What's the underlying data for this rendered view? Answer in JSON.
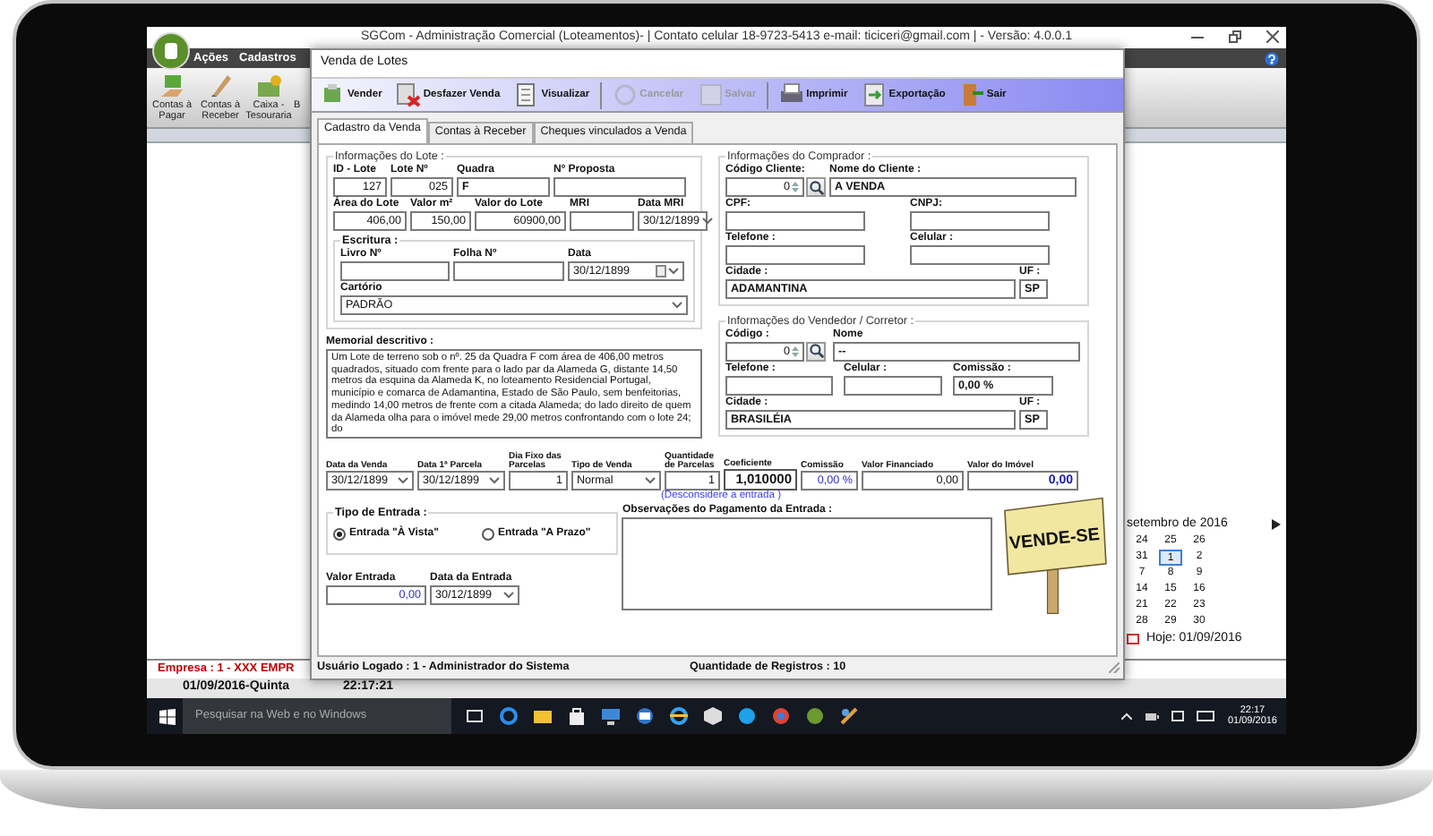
{
  "main_window": {
    "title": "SGCom - Administração Comercial (Loteamentos)- | Contato celular 18-9723-5413 e-mail: ticiceri@gmail.com | - Versão: 4.0.0.1",
    "menu": [
      {
        "label": "Ações"
      },
      {
        "label": "Cadastros"
      }
    ],
    "ribbon": [
      {
        "label": "Contas à Pagar"
      },
      {
        "label": "Contas à Receber"
      },
      {
        "label": "Caixa - Tesouraria"
      },
      {
        "label": "B"
      }
    ],
    "calendar": {
      "month": "setembro de 2016",
      "weeks": [
        [
          {
            "day": "24",
            "selected": false
          },
          {
            "day": "25",
            "selected": false
          },
          {
            "day": "26",
            "selected": false
          }
        ],
        [
          {
            "day": "31",
            "selected": false
          },
          {
            "day": "1",
            "selected": true
          },
          {
            "day": "2",
            "selected": false
          }
        ],
        [
          {
            "day": "7",
            "selected": false
          },
          {
            "day": "8",
            "selected": false
          },
          {
            "day": "9",
            "selected": false
          }
        ],
        [
          {
            "day": "14",
            "selected": false
          },
          {
            "day": "15",
            "selected": false
          },
          {
            "day": "16",
            "selected": false
          }
        ],
        [
          {
            "day": "21",
            "selected": false
          },
          {
            "day": "22",
            "selected": false
          },
          {
            "day": "23",
            "selected": false
          }
        ],
        [
          {
            "day": "28",
            "selected": false
          },
          {
            "day": "29",
            "selected": false
          },
          {
            "day": "30",
            "selected": false
          }
        ]
      ],
      "today": "Hoje: 01/09/2016"
    },
    "status": {
      "company": "Empresa : 1 - XXX EMPR",
      "date": "01/09/2016-Quinta",
      "time": "22:17:21"
    }
  },
  "dialog": {
    "title": "Venda de Lotes",
    "toolbar": [
      {
        "label": "Vender",
        "disabled": false
      },
      {
        "label": "Desfazer Venda",
        "disabled": false
      },
      {
        "label": "Visualizar",
        "disabled": false
      },
      {
        "label": "Cancelar",
        "disabled": true
      },
      {
        "label": "Salvar",
        "disabled": true
      },
      {
        "label": "Imprimir",
        "disabled": false
      },
      {
        "label": "Exportação",
        "disabled": false
      },
      {
        "label": "Sair",
        "disabled": false
      }
    ],
    "tabs": [
      {
        "label": "Cadastro da Venda",
        "selected": true
      },
      {
        "label": "Contas à Receber",
        "selected": false
      },
      {
        "label": "Cheques vinculados a Venda",
        "selected": false
      }
    ],
    "lote": {
      "title": "Informações do Lote :",
      "rows": [
        [
          {
            "label": "ID - Lote",
            "value": "127",
            "kind": "number"
          },
          {
            "label": "Lote Nº",
            "value": "025",
            "kind": "number"
          },
          {
            "label": "Quadra",
            "value": "F",
            "kind": "text"
          },
          {
            "label": "Nº Proposta",
            "kind": "text"
          }
        ],
        [
          {
            "label": "Área do Lote",
            "value": "406,00",
            "kind": "number"
          },
          {
            "label": "Valor m²",
            "value": "150,00",
            "kind": "number"
          },
          {
            "label": "Valor do Lote",
            "value": "60900,00",
            "kind": "number"
          },
          {
            "label": "MRI",
            "kind": "text"
          },
          {
            "label": "Data MRI",
            "value": "30/12/1899",
            "kind": "select"
          }
        ]
      ],
      "escritura": {
        "title": "Escritura :",
        "rows": [
          [
            {
              "label": "Livro Nº",
              "kind": "text"
            },
            {
              "label": "Folha Nº",
              "kind": "text"
            },
            {
              "label": "Data",
              "value": "30/12/1899",
              "kind": "calendar"
            }
          ],
          [
            {
              "label": "Cartório",
              "value": "PADRÃO",
              "kind": "select"
            }
          ]
        ]
      }
    },
    "memorial": {
      "label": "Memorial descritivo :",
      "text": "Um Lote de terreno sob o nº. 25 da Quadra F com área de 406,00 metros quadrados, situado com frente para o lado par da Alameda G, distante 14,50 metros da esquina da Alameda K, no loteamento Residencial Portugal, município e comarca de Adamantina, Estado de São Paulo, sem benfeitorias, medindo 14,00 metros de frente com a citada Alameda; do lado direito de quem da Alameda olha para o imóvel mede 29,00 metros confrontando com o lote 24; do"
    },
    "comprador": {
      "title": "Informações do Comprador :",
      "rows": [
        [
          {
            "label": "Código Cliente:",
            "value": "0",
            "kind": "spin",
            "lookup": true
          },
          {
            "label": "Nome do Cliente :",
            "value": "A VENDA",
            "kind": "text"
          }
        ],
        [
          {
            "label": "CPF:",
            "kind": "text"
          },
          {
            "label": "CNPJ:",
            "kind": "text"
          }
        ],
        [
          {
            "label": "Telefone :",
            "kind": "text"
          },
          {
            "label": "Celular :",
            "kind": "text"
          }
        ],
        [
          {
            "label": "Cidade :",
            "value": "ADAMANTINA",
            "kind": "text"
          },
          {
            "label": "UF :",
            "value": "SP",
            "kind": "text"
          }
        ]
      ]
    },
    "vendedor": {
      "title": "Informações do Vendedor / Corretor :",
      "rows": [
        [
          {
            "label": "Código :",
            "value": "0",
            "kind": "spin",
            "lookup": true
          },
          {
            "label": "Nome",
            "value": "--",
            "kind": "text"
          }
        ],
        [
          {
            "label": "Telefone :",
            "kind": "text"
          },
          {
            "label": "Celular :",
            "kind": "text"
          },
          {
            "label": "Comissão :",
            "value": "0,00 %",
            "kind": "text"
          }
        ],
        [
          {
            "label": "Cidade :",
            "value": "BRASILÉIA",
            "kind": "text"
          },
          {
            "label": "UF :",
            "value": "SP",
            "kind": "text"
          }
        ]
      ]
    },
    "pagamento": {
      "fields": [
        {
          "label": "Data da Venda",
          "value": "30/12/1899",
          "kind": "select"
        },
        {
          "label": "Data 1ª Parcela",
          "value": "30/12/1899",
          "kind": "select"
        },
        {
          "label": "Dia Fixo das Parcelas",
          "value": "1",
          "kind": "number"
        },
        {
          "label": "Tipo de Venda",
          "value": "Normal",
          "kind": "select"
        },
        {
          "label": "Quantidade de Parcelas",
          "value": "1",
          "kind": "number"
        },
        {
          "label": "Coeficiente",
          "value": "1,010000",
          "kind": "coef"
        },
        {
          "label": "Comissão",
          "value": "0,00 %",
          "kind": "percent"
        },
        {
          "label": "Valor Financiado",
          "value": "0,00",
          "kind": "number"
        },
        {
          "label": "Valor do Imóvel",
          "value": "0,00",
          "kind": "total"
        }
      ],
      "note": "(Desconsidere a entrada )"
    },
    "tipo_entrada": {
      "title": "Tipo de Entrada :",
      "options": [
        {
          "label": "Entrada \"À Vista\"",
          "selected": true
        },
        {
          "label": "Entrada \"A Prazo\"",
          "selected": false
        }
      ]
    },
    "entrada": {
      "fields": [
        {
          "label": "Valor Entrada",
          "value": "0,00",
          "kind": "percent"
        },
        {
          "label": "Data da Entrada",
          "value": "30/12/1899",
          "kind": "select"
        }
      ]
    },
    "observacoes": {
      "label": "Observações do Pagamento da Entrada :"
    },
    "sign": {
      "text": "VENDE-SE"
    },
    "status": {
      "user": "Usuário Logado : 1 - Administrador do Sistema",
      "records": "Quantidade de Registros : 10"
    }
  },
  "taskbar": {
    "search_placeholder": "Pesquisar na Web e no Windows",
    "time": "22:17",
    "date": "01/09/2016"
  }
}
